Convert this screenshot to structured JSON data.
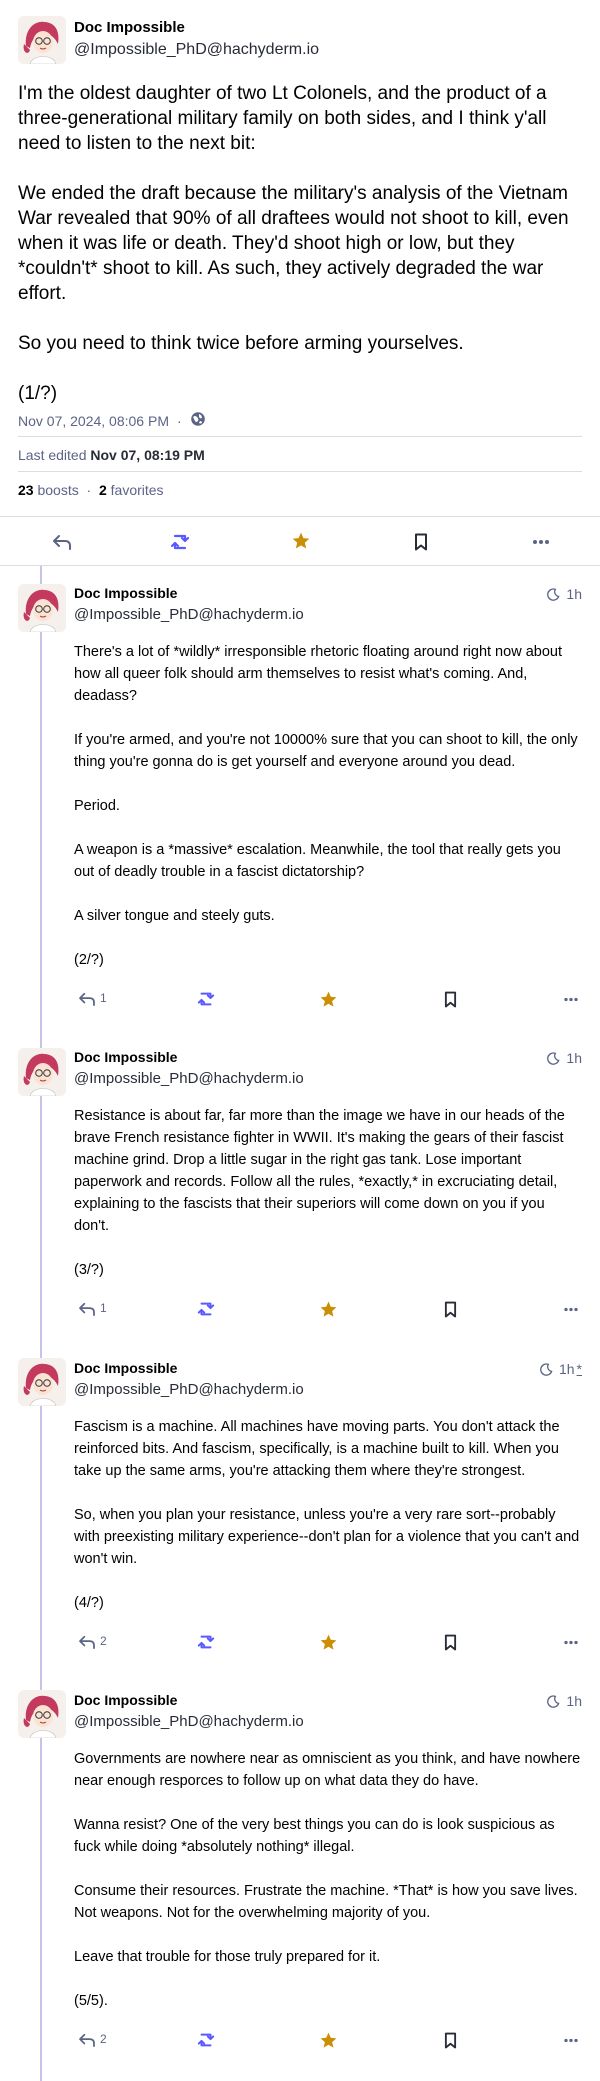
{
  "main": {
    "name": "Doc Impossible",
    "handle": "@Impossible_PhD@hachyderm.io",
    "paragraphs": [
      "I'm the oldest daughter of two Lt Colonels, and the product of a three-generational military family on both sides, and I think y'all need to listen to the next bit:",
      "We ended the draft because the military's analysis of the Vietnam War revealed that 90% of all draftees would not shoot to kill, even when it was life or death. They'd shoot high or low, but they *couldn't* shoot to kill. As such, they actively degraded the war effort.",
      "So you need to think twice before arming yourselves.",
      "(1/?)"
    ],
    "date": "Nov 07, 2024, 08:06 PM",
    "separator": "·",
    "edited_prefix": "Last edited",
    "edited_date": "Nov 07, 08:19 PM",
    "boosts_count": "23",
    "boosts_label": "boosts",
    "dot": "·",
    "favorites_count": "2",
    "favorites_label": "favorites"
  },
  "replies": [
    {
      "name": "Doc Impossible",
      "handle": "@Impossible_PhD@hachyderm.io",
      "time": "1h",
      "edited_mark": "",
      "reply_count": "1",
      "paragraphs": [
        "There's a lot of *wildly* irresponsible rhetoric floating around right now about how all queer folk should arm themselves to resist what's coming. And, deadass?",
        "If you're armed, and you're not 10000% sure that you can shoot to kill, the only thing you're gonna do is get yourself and everyone around you dead.",
        "Period.",
        "A weapon is a *massive* escalation. Meanwhile, the tool that really gets you out of deadly trouble in a fascist dictatorship?",
        "A silver tongue and steely guts.",
        "(2/?)"
      ]
    },
    {
      "name": "Doc Impossible",
      "handle": "@Impossible_PhD@hachyderm.io",
      "time": "1h",
      "edited_mark": "",
      "reply_count": "1",
      "paragraphs": [
        "Resistance is about far, far more than the image we have in our heads of the brave French resistance fighter in WWII. It's making the gears of their fascist machine grind. Drop a little sugar in the right gas tank. Lose important paperwork and records. Follow all the rules, *exactly,* in excruciating detail, explaining to the fascists that their superiors will come down on you if you don't.",
        "(3/?)"
      ]
    },
    {
      "name": "Doc Impossible",
      "handle": "@Impossible_PhD@hachyderm.io",
      "time": "1h",
      "edited_mark": "*",
      "reply_count": "2",
      "paragraphs": [
        "Fascism is a machine. All machines have moving parts. You don't attack the reinforced bits. And fascism, specifically, is a machine built to kill. When you take up the same arms, you're attacking them where they're strongest.",
        "So, when you plan your resistance, unless you're a very rare sort--probably with preexisting military experience--don't plan for a violence that you can't and won't win.",
        "(4/?)"
      ]
    },
    {
      "name": "Doc Impossible",
      "handle": "@Impossible_PhD@hachyderm.io",
      "time": "1h",
      "edited_mark": "",
      "reply_count": "2",
      "paragraphs": [
        "Governments are nowhere near as omniscient as you think, and have nowhere near enough resporces to follow up on what data they do have.",
        "Wanna resist? One of the very best things you can do is look suspicious as fuck while doing *absolutely nothing* illegal.",
        "Consume their resources. Frustrate the machine. *That* is how you save lives. Not weapons. Not for the overwhelming majority of you.",
        "Leave that trouble for those truly prepared for it.",
        "(5/5)."
      ]
    }
  ],
  "colors": {
    "accent": "#595aff",
    "star": "#ca8f04",
    "icon": "#5c6486",
    "thread_line": "#c9c3ec"
  },
  "icons": {
    "reply": "reply-icon",
    "boost": "boost-icon",
    "favorite": "star-icon",
    "bookmark": "bookmark-icon",
    "more": "more-icon",
    "visibility": "globe-icon",
    "time": "moon-icon"
  }
}
